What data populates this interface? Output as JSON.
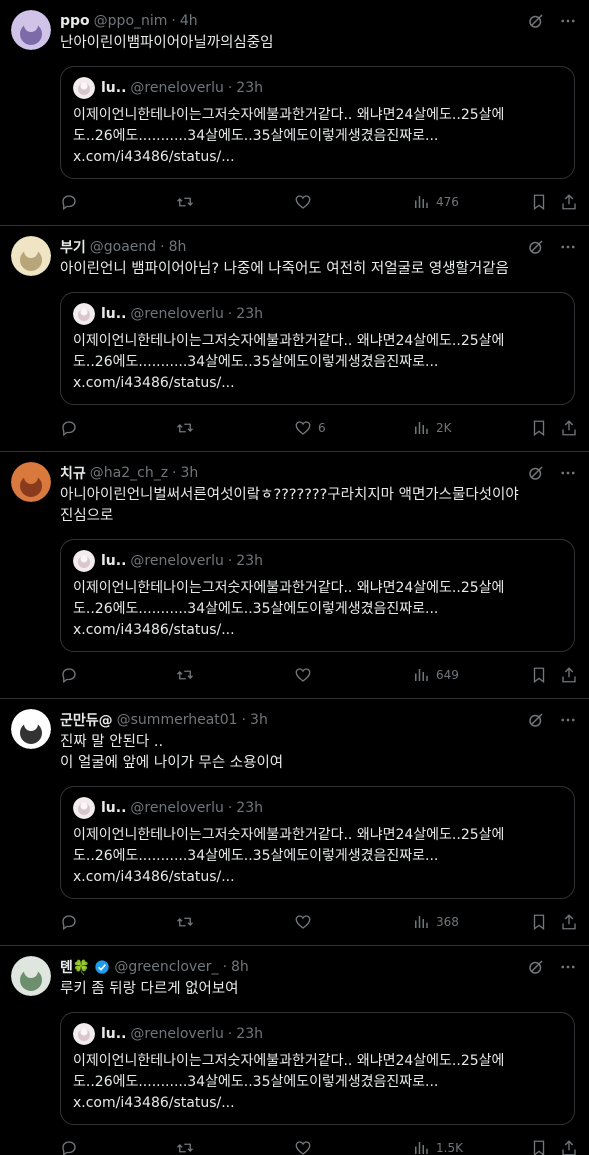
{
  "tweets": [
    {
      "name": "ppo",
      "handle": "@ppo_nim",
      "time": "4h",
      "text": "난아이린이뱀파이어아닐까의심중임",
      "avatar_colors": [
        "#cfc3e8",
        "#7d6aa8"
      ],
      "quote": {
        "name": "lu..",
        "handle": "@reneloverlu",
        "time": "23h",
        "text_line1": "이제이언니한테나이는그저숫자에불과한거같다.. 왜냐면24살에도..25살에",
        "text_line2": "도..26에도...........34살에도..35살에도이렇게생겼음진짜로...",
        "text_line3": "x.com/i43486/status/..."
      },
      "likes": "",
      "views": "476"
    },
    {
      "name": "부기",
      "handle": "@goaend",
      "time": "8h",
      "text": "아이린언니 뱀파이어아님? 나중에 나죽어도 여전히 저얼굴로 영생할거같음",
      "avatar_colors": [
        "#efe4c4",
        "#b9a57a"
      ],
      "quote": {
        "name": "lu..",
        "handle": "@reneloverlu",
        "time": "23h",
        "text_line1": "이제이언니한테나이는그저숫자에불과한거같다.. 왜냐면24살에도..25살에",
        "text_line2": "도..26에도...........34살에도..35살에도이렇게생겼음진짜로...",
        "text_line3": "x.com/i43486/status/..."
      },
      "likes": "6",
      "views": "2K"
    },
    {
      "name": "치규",
      "handle": "@ha2_ch_z",
      "time": "3h",
      "text": "아니아이린언니벌써서른여섯이랔ㅎ???????구라치지마 액면가스물다섯이야\n진심으로",
      "avatar_colors": [
        "#d9793e",
        "#8a3b1e"
      ],
      "quote": {
        "name": "lu..",
        "handle": "@reneloverlu",
        "time": "23h",
        "text_line1": "이제이언니한테나이는그저숫자에불과한거같다.. 왜냐면24살에도..25살에",
        "text_line2": "도..26에도...........34살에도..35살에도이렇게생겼음진짜로...",
        "text_line3": "x.com/i43486/status/..."
      },
      "likes": "",
      "views": "649"
    },
    {
      "name": "군만듀@",
      "handle": "@summerheat01",
      "time": "3h",
      "text": "진짜 말 안된다 ..\n이 얼굴에 앞에 나이가 무슨 소용이여",
      "avatar_colors": [
        "#ffffff",
        "#333333"
      ],
      "quote": {
        "name": "lu..",
        "handle": "@reneloverlu",
        "time": "23h",
        "text_line1": "이제이언니한테나이는그저숫자에불과한거같다.. 왜냐면24살에도..25살에",
        "text_line2": "도..26에도...........34살에도..35살에도이렇게생겼음진짜로...",
        "text_line3": "x.com/i43486/status/..."
      },
      "likes": "",
      "views": "368"
    },
    {
      "name": "톈🍀",
      "handle": "@greenclover_",
      "time": "8h",
      "text": "루키 좀 뒤랑 다르게 없어보여",
      "avatar_colors": [
        "#dfe6df",
        "#6e8f6e"
      ],
      "verified": true,
      "quote": {
        "name": "lu..",
        "handle": "@reneloverlu",
        "time": "23h",
        "text_line1": "이제이언니한테나이는그저숫자에불과한거같다.. 왜냐면24살에도..25살에",
        "text_line2": "도..26에도...........34살에도..35살에도이렇게생겼음진짜로...",
        "text_line3": "x.com/i43486/status/..."
      },
      "likes": "",
      "views": "1.5K"
    }
  ],
  "colors": {
    "background": "#000000",
    "text": "#e7e9ea",
    "secondary": "#71767b",
    "border": "#2f3336",
    "verified": "#1d9bf0"
  },
  "icons": [
    "grok-icon",
    "more-icon",
    "reply-icon",
    "retweet-icon",
    "like-icon",
    "views-icon",
    "bookmark-icon",
    "share-icon",
    "verified-badge-icon"
  ]
}
